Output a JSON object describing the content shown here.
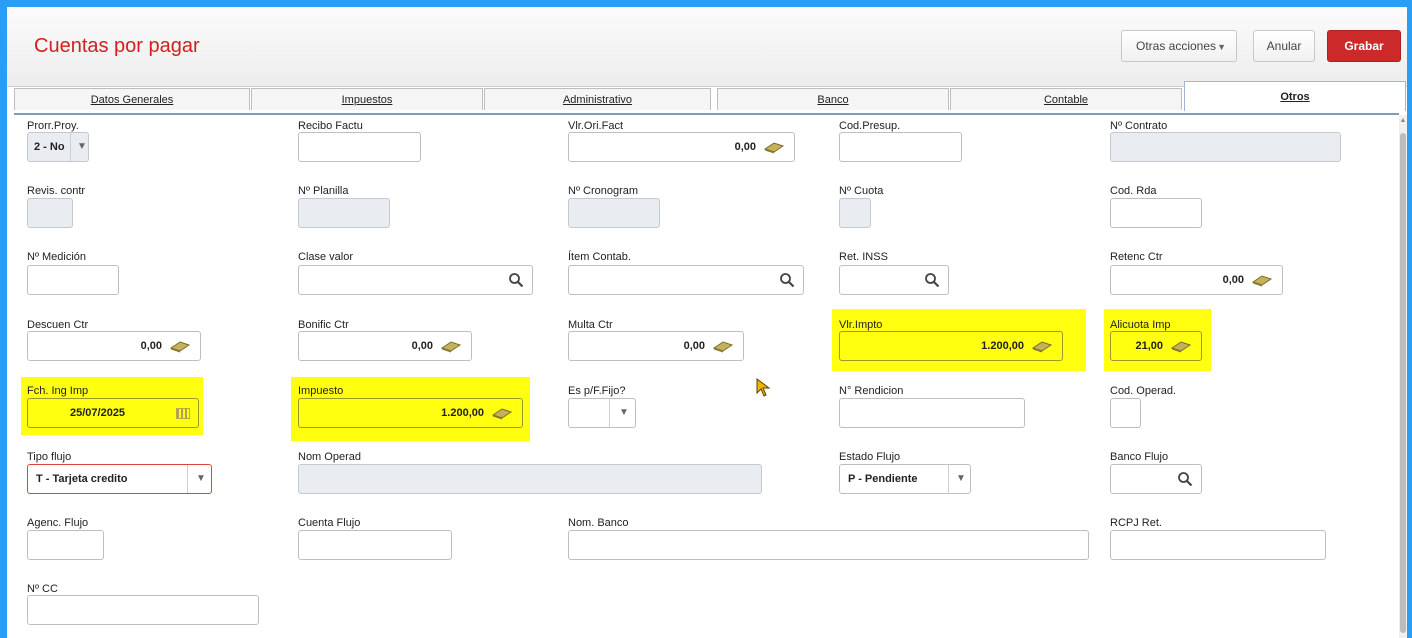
{
  "header": {
    "title": "Cuentas por pagar",
    "otras_acciones": "Otras acciones",
    "anular": "Anular",
    "grabar": "Grabar"
  },
  "tabs": [
    {
      "label": "Datos Generales",
      "active": false
    },
    {
      "label": "Impuestos",
      "active": false
    },
    {
      "label": "Administrativo",
      "active": false
    },
    {
      "label": "Banco",
      "active": false
    },
    {
      "label": "Contable",
      "active": false
    },
    {
      "label": "Otros",
      "active": true
    }
  ],
  "highlight_color": "#ffff0f",
  "accent_color": "#cc2a2a",
  "fields": {
    "prorr_proy": {
      "label": "Prorr.Proy.",
      "value": "2 - No"
    },
    "recibo_factu": {
      "label": "Recibo Factu",
      "value": ""
    },
    "vlr_ori_fact": {
      "label": "Vlr.Ori.Fact",
      "value": "0,00"
    },
    "cod_presup": {
      "label": "Cod.Presup.",
      "value": ""
    },
    "nro_contrato": {
      "label": "Nº Contrato",
      "value": ""
    },
    "revis_contr": {
      "label": "Revis. contr",
      "value": ""
    },
    "nro_planilla": {
      "label": "Nº Planilla",
      "value": ""
    },
    "nro_cronogram": {
      "label": "Nº Cronogram",
      "value": ""
    },
    "nro_cuota": {
      "label": "Nº Cuota",
      "value": ""
    },
    "cod_rda": {
      "label": "Cod. Rda",
      "value": ""
    },
    "nro_medicion": {
      "label": "Nº Medición",
      "value": ""
    },
    "clase_valor": {
      "label": "Clase valor",
      "value": ""
    },
    "item_contab": {
      "label": "Ítem Contab.",
      "value": ""
    },
    "ret_inss": {
      "label": "Ret. INSS",
      "value": ""
    },
    "retenc_ctr": {
      "label": "Retenc Ctr",
      "value": "0,00"
    },
    "descuen_ctr": {
      "label": "Descuen Ctr",
      "value": "0,00"
    },
    "bonific_ctr": {
      "label": "Bonific Ctr",
      "value": "0,00"
    },
    "multa_ctr": {
      "label": "Multa Ctr",
      "value": "0,00"
    },
    "vlr_impto": {
      "label": "Vlr.Impto",
      "value": "1.200,00"
    },
    "alicuota_imp": {
      "label": "Alicuota Imp",
      "value": "21,00"
    },
    "fch_ing_imp": {
      "label": "Fch. Ing Imp",
      "value": "25/07/2025"
    },
    "impuesto": {
      "label": "Impuesto",
      "value": "1.200,00"
    },
    "es_pf_fijo": {
      "label": "Es p/F.Fijo?",
      "value": ""
    },
    "nro_rendicion": {
      "label": "N° Rendicion",
      "value": ""
    },
    "cod_operad": {
      "label": "Cod. Operad.",
      "value": ""
    },
    "tipo_flujo": {
      "label": "Tipo flujo",
      "value": "T - Tarjeta credito"
    },
    "nom_operad": {
      "label": "Nom Operad",
      "value": ""
    },
    "estado_flujo": {
      "label": "Estado Flujo",
      "value": "P - Pendiente"
    },
    "banco_flujo": {
      "label": "Banco Flujo",
      "value": ""
    },
    "agenc_flujo": {
      "label": "Agenc. Flujo",
      "value": ""
    },
    "cuenta_flujo": {
      "label": "Cuenta Flujo",
      "value": ""
    },
    "nom_banco": {
      "label": "Nom. Banco",
      "value": ""
    },
    "rcpj_ret": {
      "label": "RCPJ Ret.",
      "value": ""
    },
    "nro_cc": {
      "label": "Nº CC",
      "value": ""
    }
  }
}
